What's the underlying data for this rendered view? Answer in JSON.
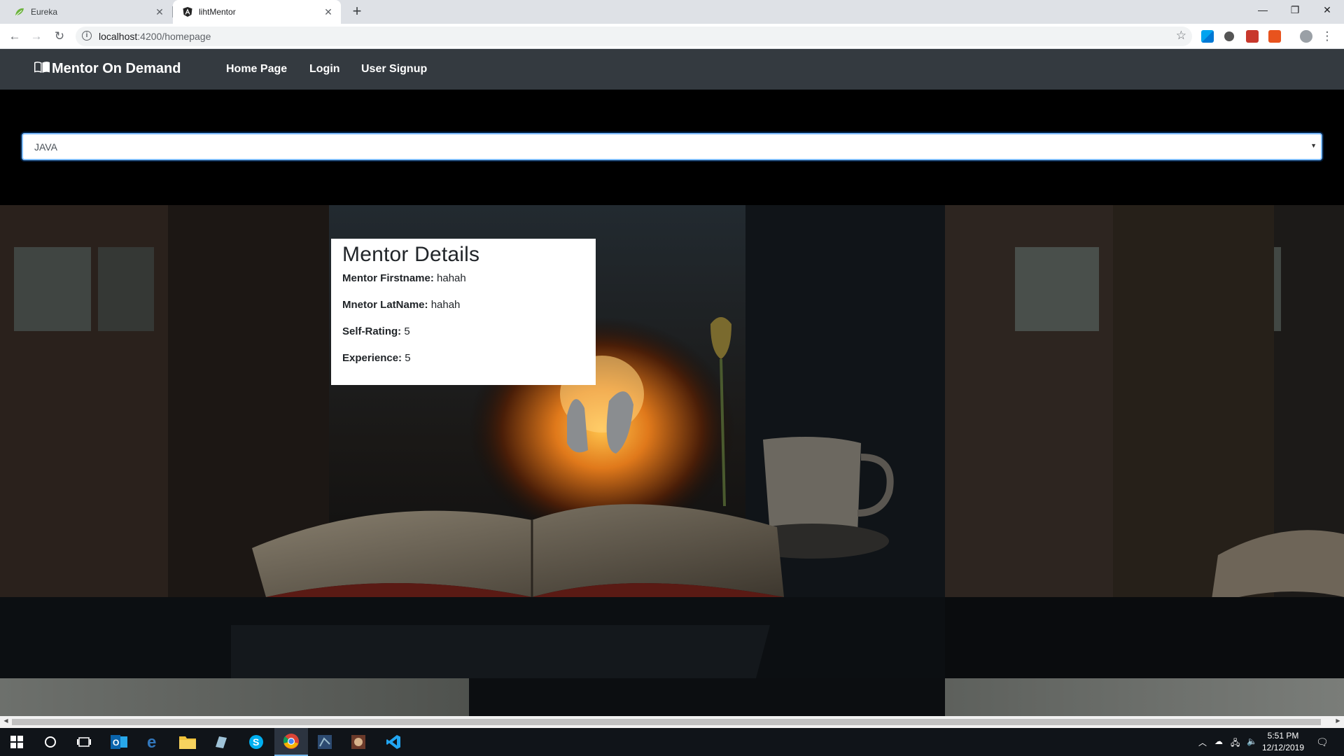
{
  "browser": {
    "tabs": [
      {
        "title": "Eureka",
        "active": false
      },
      {
        "title": "lihtMentor",
        "active": true
      }
    ],
    "url_host": "localhost",
    "url_path": ":4200/homepage"
  },
  "app": {
    "brand": "Mentor On Demand",
    "nav": [
      {
        "label": "Home Page"
      },
      {
        "label": "Login"
      },
      {
        "label": "User Signup"
      }
    ]
  },
  "technology_select": {
    "selected": "JAVA"
  },
  "mentor_details": {
    "title": "Mentor Details",
    "fields": [
      {
        "label": "Mentor Firstname:",
        "value": "hahah"
      },
      {
        "label": "Mnetor LatName:",
        "value": "hahah"
      },
      {
        "label": "Self-Rating:",
        "value": "5"
      },
      {
        "label": "Experience:",
        "value": "5"
      }
    ]
  },
  "taskbar": {
    "time": "5:51 PM",
    "date": "12/12/2019"
  },
  "colors": {
    "navbar": "#343a40",
    "focus_border": "#80bdff",
    "tab_strip": "#dee1e6",
    "taskbar": "#101419"
  }
}
